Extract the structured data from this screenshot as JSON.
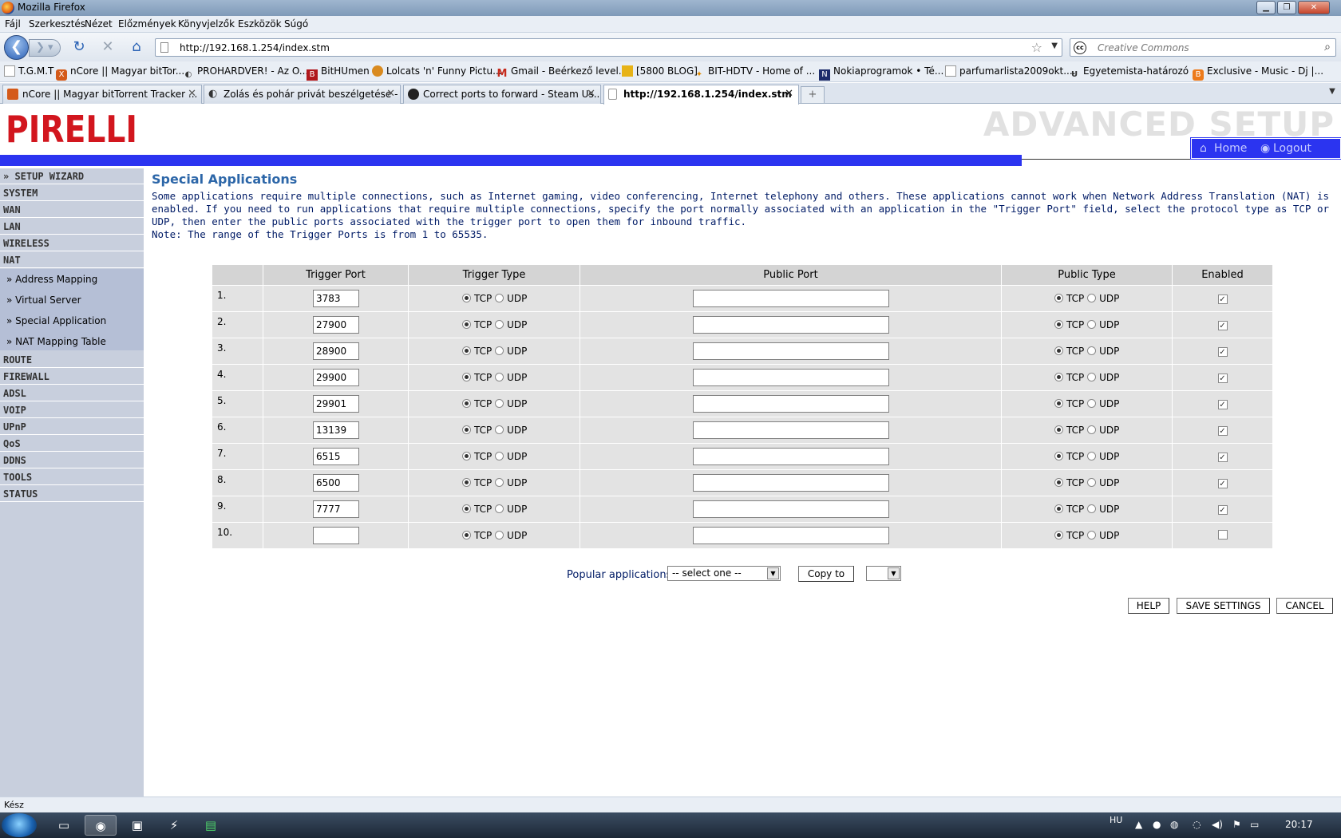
{
  "window": {
    "title": "Mozilla Firefox"
  },
  "menu": [
    "Fájl",
    "Szerkesztés",
    "Nézet",
    "Előzmények",
    "Könyvjelzők",
    "Eszközök",
    "Súgó"
  ],
  "address": {
    "url": "http://192.168.1.254/index.stm"
  },
  "search": {
    "placeholder": "Creative Commons"
  },
  "bookmarks": [
    "T.G.M.T",
    "nCore || Magyar bitTor...",
    "PROHARDVER! - Az O...",
    "BitHUmen",
    "Lolcats 'n' Funny Pictu...",
    "Gmail - Beérkező level...",
    "[5800 BLOG]",
    "BIT-HDTV - Home of ...",
    "Nokiaprogramok • Té...",
    "parfumarlista2009okt....",
    "Egyetemista-határozó ...",
    "Exclusive - Music - Dj |..."
  ],
  "tabs": [
    {
      "label": "nCore || Magyar bitTorrent Tracker ..."
    },
    {
      "label": "Zolás és pohár privát beszélgetése - ..."
    },
    {
      "label": "Correct ports to forward - Steam Us..."
    },
    {
      "label": "http://192.168.1.254/index.stm",
      "active": true
    }
  ],
  "header": {
    "logo": "PIRELLI",
    "title": "ADVANCED SETUP",
    "home": "Home",
    "logout": "Logout"
  },
  "sidebar": {
    "items": [
      "» SETUP WIZARD",
      "SYSTEM",
      "WAN",
      "LAN",
      "WIRELESS",
      "NAT"
    ],
    "sub": [
      "» Address Mapping",
      "» Virtual Server",
      "» Special Application",
      "» NAT Mapping Table"
    ],
    "items2": [
      "ROUTE",
      "FIREWALL",
      "ADSL",
      "VOIP",
      "UPnP",
      "QoS",
      "DDNS",
      "TOOLS",
      "STATUS"
    ]
  },
  "page": {
    "title": "Special Applications",
    "description": "Some applications require multiple connections, such as Internet gaming, video conferencing, Internet telephony and others. These applications cannot work when Network Address Translation (NAT) is enabled. If you need to run applications that require multiple connections, specify the port normally associated with an application in the \"Trigger Port\" field, select the protocol type as TCP or UDP, then enter the public ports associated with the trigger port to open them for inbound traffic.",
    "note": "Note: The range of the Trigger Ports is from 1 to 65535."
  },
  "table": {
    "headers": [
      "Trigger Port",
      "Trigger Type",
      "Public Port",
      "Public Type",
      "Enabled"
    ],
    "tcp": "TCP",
    "udp": "UDP",
    "rows": [
      {
        "num": "1.",
        "trigger_port": "3783",
        "public_port": "",
        "enabled": true
      },
      {
        "num": "2.",
        "trigger_port": "27900",
        "public_port": "",
        "enabled": true
      },
      {
        "num": "3.",
        "trigger_port": "28900",
        "public_port": "",
        "enabled": true
      },
      {
        "num": "4.",
        "trigger_port": "29900",
        "public_port": "",
        "enabled": true
      },
      {
        "num": "5.",
        "trigger_port": "29901",
        "public_port": "",
        "enabled": true
      },
      {
        "num": "6.",
        "trigger_port": "13139",
        "public_port": "",
        "enabled": true
      },
      {
        "num": "7.",
        "trigger_port": "6515",
        "public_port": "",
        "enabled": true
      },
      {
        "num": "8.",
        "trigger_port": "6500",
        "public_port": "",
        "enabled": true
      },
      {
        "num": "9.",
        "trigger_port": "7777",
        "public_port": "",
        "enabled": true
      },
      {
        "num": "10.",
        "trigger_port": "",
        "public_port": "",
        "enabled": false
      }
    ]
  },
  "popular": {
    "label": "Popular applications",
    "select": "-- select one --",
    "copy_to": "Copy to",
    "target": ""
  },
  "buttons": {
    "help": "HELP",
    "save": "SAVE SETTINGS",
    "cancel": "CANCEL"
  },
  "status": "Kész",
  "taskbar": {
    "lang": "HU",
    "time": "20:17"
  },
  "colors": {
    "accent_blue": "#2b34f0",
    "title_blue": "#2c66a8",
    "logo_red": "#d2161e",
    "sidebar": "#c8cfdd"
  }
}
